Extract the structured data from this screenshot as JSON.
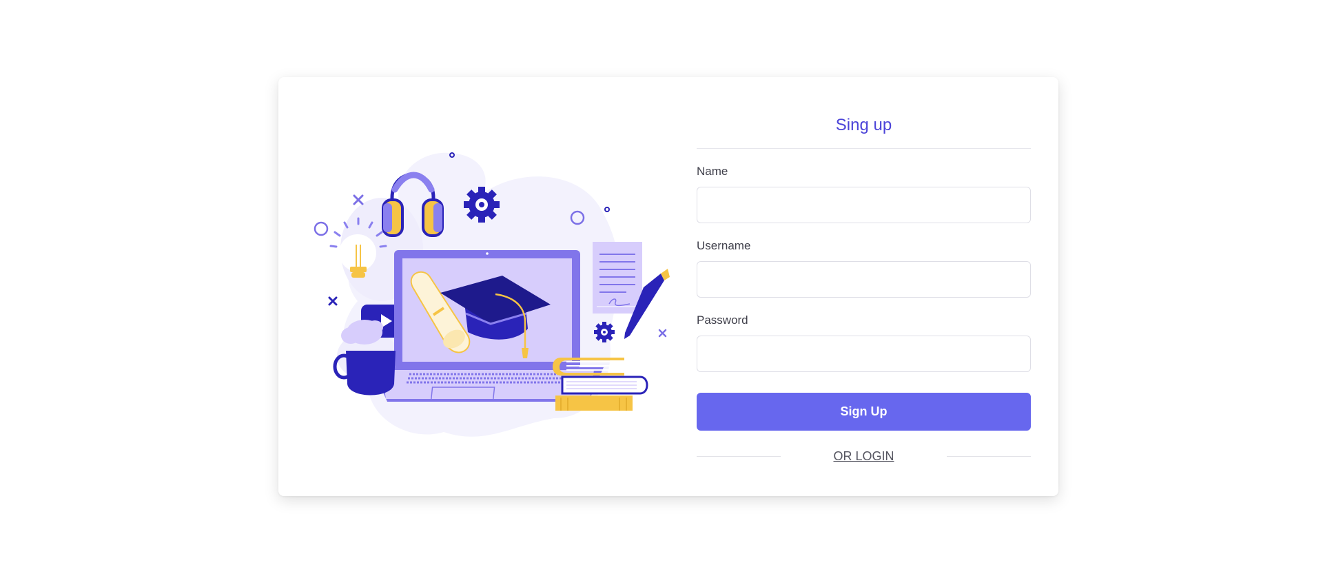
{
  "form": {
    "title": "Sing up",
    "fields": [
      {
        "label": "Name",
        "value": "",
        "placeholder": ""
      },
      {
        "label": "Username",
        "value": "",
        "placeholder": ""
      },
      {
        "label": "Password",
        "value": "",
        "placeholder": ""
      }
    ],
    "submit_label": "Sign Up",
    "alt_link_label": "OR LOGIN"
  },
  "colors": {
    "accent": "#4c44d8",
    "button": "#6767ee",
    "illustration_navy": "#2a23b8",
    "illustration_lavender": "#d7cdfc",
    "illustration_yellow": "#f6c445",
    "blob": "#f2f1fd"
  }
}
